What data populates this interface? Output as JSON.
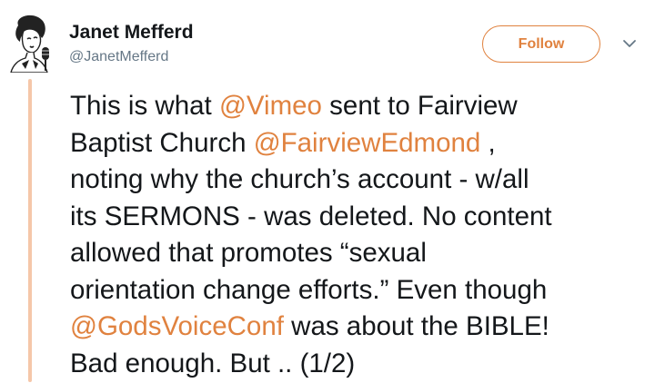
{
  "tweet": {
    "display_name": "Janet Mefferd",
    "handle": "@JanetMefferd",
    "follow_label": "Follow",
    "colors": {
      "accent": "#e0823f",
      "thread_line": "#f5c7a9",
      "text": "#14171a",
      "secondary_text": "#657786"
    },
    "icons": {
      "avatar": "retro-woman-microphone-avatar",
      "menu": "chevron-down-icon"
    },
    "text": {
      "l1a": "This is what ",
      "m1": "@Vimeo",
      "l1b": " sent to Fairview",
      "l2a": "Baptist Church ",
      "m2": "@FairviewEdmond",
      "l2b": " ,",
      "l3": "noting why the church’s account - w/all",
      "l4": "its SERMONS - was deleted. No content",
      "l5": "allowed that promotes “sexual",
      "l6": "orientation change efforts.” Even though",
      "m3": "@GodsVoiceConf",
      "l7b": " was about the BIBLE!",
      "l8": "Bad enough. But .. (1/2)"
    }
  }
}
